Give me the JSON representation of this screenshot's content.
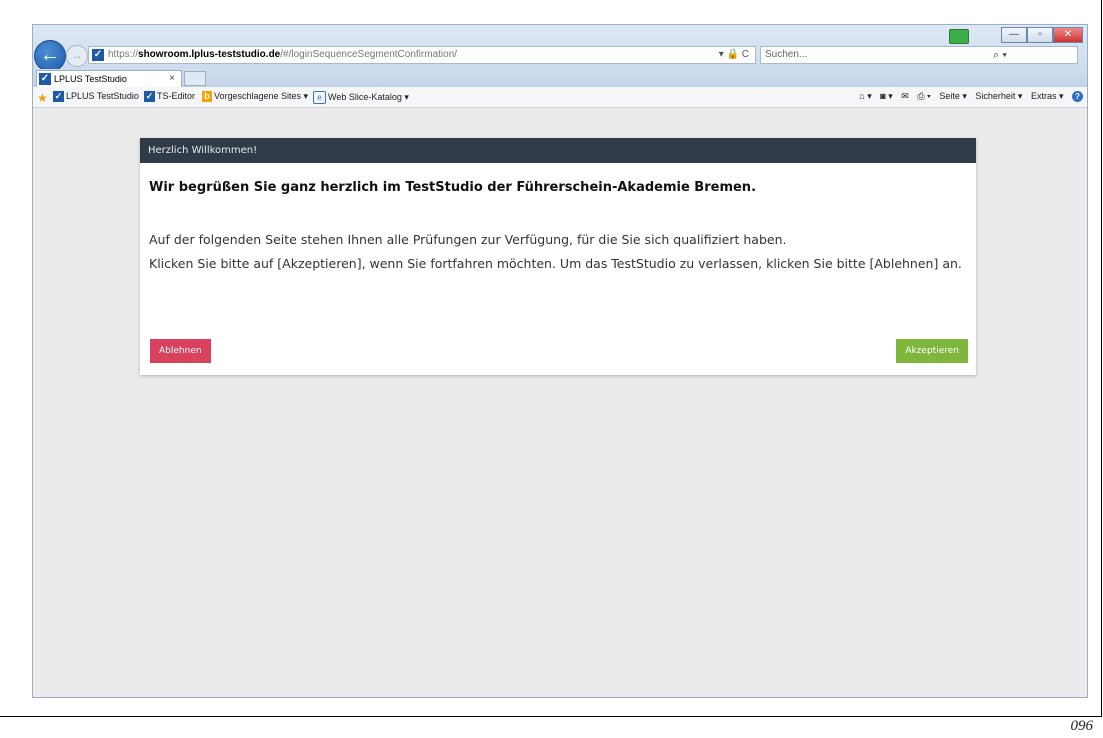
{
  "browser": {
    "url_prefix": "https://",
    "url_domain": "showroom.lplus-teststudio.de",
    "url_path": "/#/loginSequenceSegmentConfirmation/",
    "address_controls": "▾ 🔒 C",
    "search_placeholder": "Suchen...",
    "tab_title": "LPLUS TestStudio",
    "tab_close": "×"
  },
  "favorites": {
    "items": [
      {
        "label": "LPLUS TestStudio",
        "icon": "check-icon"
      },
      {
        "label": "TS-Editor",
        "icon": "check-icon"
      },
      {
        "label": "Vorgeschlagene Sites ▾",
        "icon": "bing-icon"
      },
      {
        "label": "Web Slice-Katalog ▾",
        "icon": "ie-icon"
      }
    ],
    "commands": [
      "Seite ▾",
      "Sicherheit ▾",
      "Extras ▾"
    ]
  },
  "dialog": {
    "header": "Herzlich Willkommen!",
    "title": "Wir begrüßen Sie ganz herzlich im TestStudio der Führerschein-Akademie Bremen.",
    "line1": "Auf der folgenden Seite stehen Ihnen alle Prüfungen zur Verfügung, für die Sie sich qualifiziert haben.",
    "line2": "Klicken Sie bitte auf [Akzeptieren], wenn Sie fortfahren möchten. Um das TestStudio zu verlassen, klicken Sie bitte [Ablehnen] an.",
    "decline_label": "Ablehnen",
    "accept_label": "Akzeptieren"
  },
  "colors": {
    "header_bg": "#2f3b47",
    "decline": "#d9425e",
    "accept": "#7fb73d"
  },
  "page_number": "096"
}
